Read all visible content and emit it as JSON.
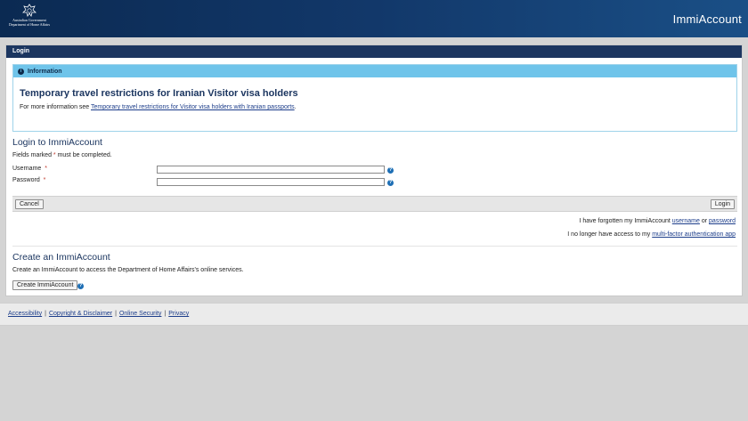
{
  "header": {
    "crest_line1": "Australian Government",
    "crest_line2": "Department of Home Affairs",
    "app_title": "ImmiAccount"
  },
  "panel": {
    "title": "Login"
  },
  "info": {
    "label": "Information",
    "title": "Temporary travel restrictions for Iranian Visitor visa holders",
    "text_prefix": "For more information see ",
    "link_text": "Temporary travel restrictions for Visitor visa holders with Iranian passports",
    "text_suffix": "."
  },
  "login": {
    "heading": "Login to ImmiAccount",
    "fields_note_prefix": "Fields marked ",
    "fields_note_star": "*",
    "fields_note_suffix": " must be completed.",
    "username_label": "Username",
    "password_label": "Password",
    "required_mark": "*",
    "username_value": "",
    "password_value": "",
    "cancel_label": "Cancel",
    "login_label": "Login",
    "forgot_prefix": "I have forgotten my ImmiAccount ",
    "forgot_username": "username",
    "forgot_or": " or ",
    "forgot_password": "password",
    "mfa_prefix": "I no longer have access to my ",
    "mfa_link": "multi-factor authentication app"
  },
  "create": {
    "heading": "Create an ImmiAccount",
    "text": "Create an ImmiAccount to access the Department of Home Affairs's online services.",
    "button_label": "Create ImmiAccount"
  },
  "footer": {
    "links": [
      "Accessibility",
      "Copyright & Disclaimer",
      "Online Security",
      "Privacy"
    ],
    "separator": "|"
  },
  "colors": {
    "header_dark": "#0b2a52",
    "panel_head": "#1c3660",
    "info_head": "#6fc4ea",
    "help_icon": "#1e6fb5"
  }
}
